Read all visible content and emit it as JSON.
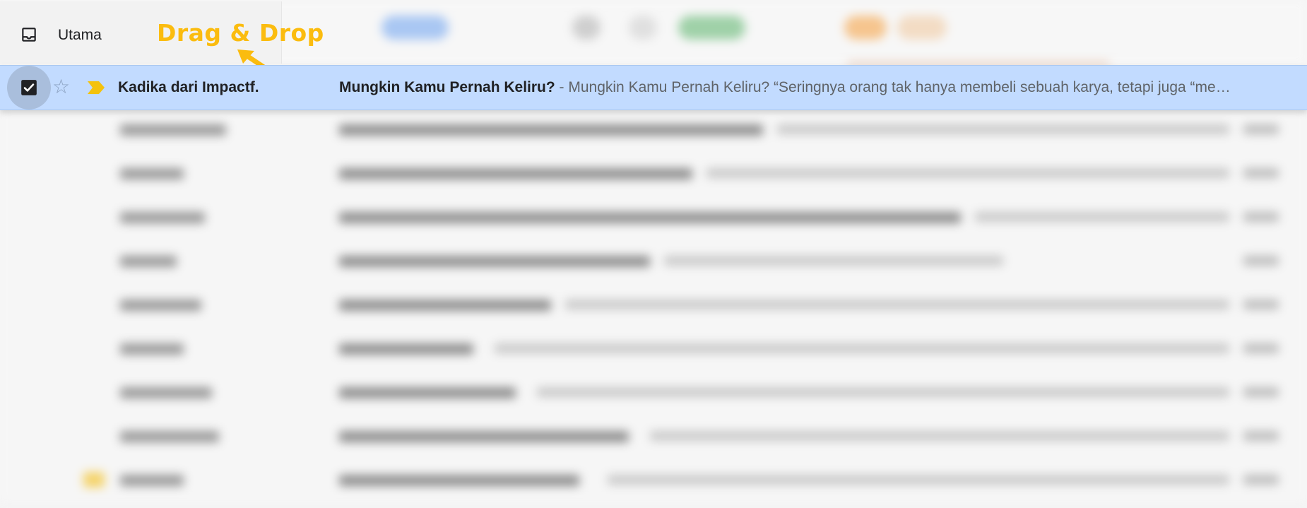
{
  "tabs": {
    "active": {
      "label": "Utama",
      "icon": "inbox-icon"
    }
  },
  "annotation": {
    "text": "Drag & Drop",
    "color": "#fbbc0f",
    "icon": "arrow-icon"
  },
  "selected_email": {
    "checked": true,
    "starred": false,
    "important": true,
    "sender": "Kadika dari Impactf.",
    "subject": "Mungkin Kamu Pernah Keliru?",
    "snippet": " - Mungkin Kamu Pernah Keliru? “Seringnya orang tak hanya membeli sebuah karya, tetapi juga “me…",
    "row_color": "#c2dbff",
    "importance_color": "#f4c20d"
  }
}
